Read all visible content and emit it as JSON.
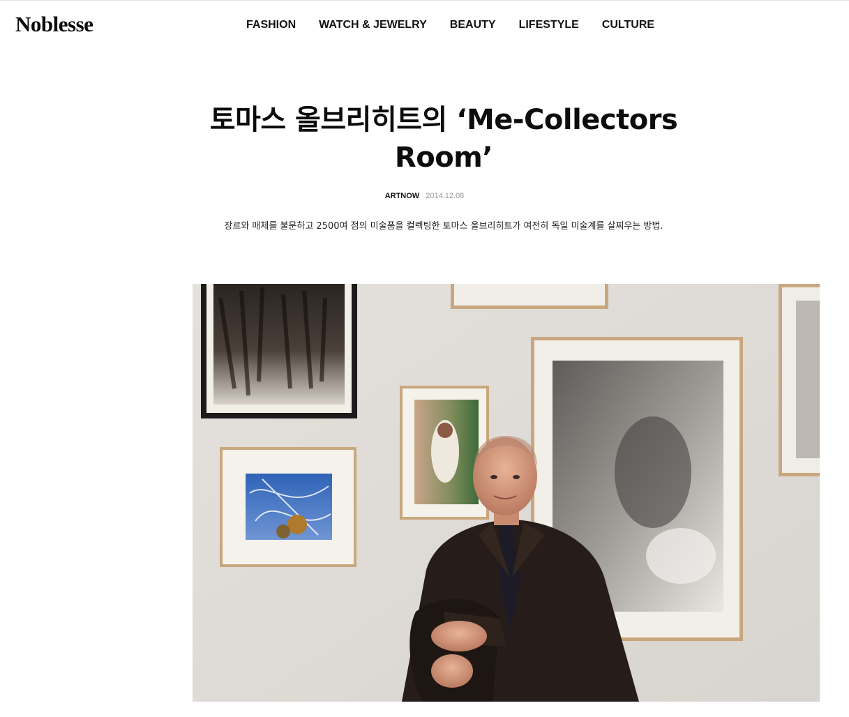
{
  "header": {
    "logo": "Noblesse",
    "nav": [
      "FASHION",
      "WATCH & JEWELRY",
      "BEAUTY",
      "LIFESTYLE",
      "CULTURE"
    ]
  },
  "article": {
    "title": "토마스 올브리히트의 ‘Me-Collectors Room’",
    "category": "ARTNOW",
    "date": "2014.12.08",
    "summary": "장르와 매체를 불문하고 2500여 점의 미술품을 컬렉팅한 토마스 올브리히트가 여전히 독일 미술계를 살찌우는 방법."
  },
  "colors": {
    "text": "#111111",
    "date": "#9a9a9a",
    "wall": "#dedbd6",
    "suit": "#2a1f1c"
  },
  "icons": []
}
